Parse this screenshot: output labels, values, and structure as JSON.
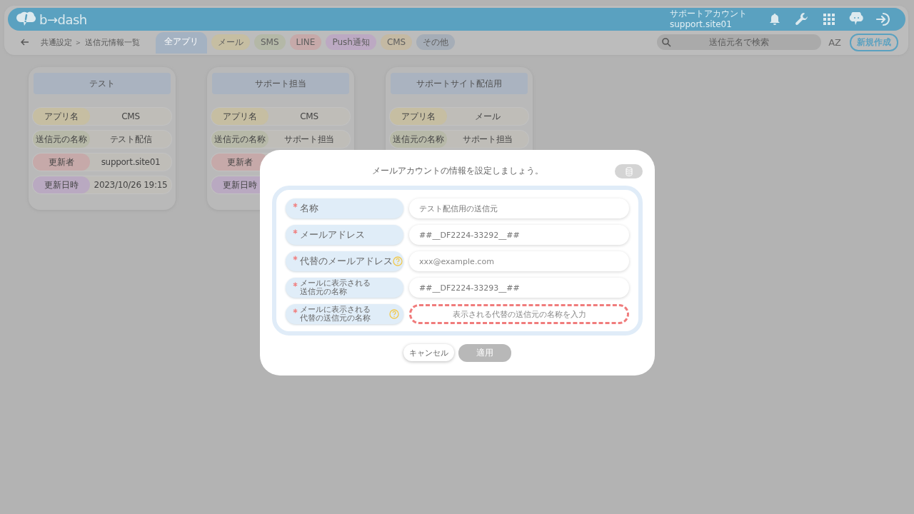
{
  "header": {
    "logo": "b→dash",
    "account_name": "サポートアカウント",
    "account_id": "support.site01"
  },
  "toolbar": {
    "breadcrumb": "共通設定 ＞ 送信元情報一覧",
    "filters": [
      {
        "label": "全アプリ",
        "selected": true,
        "color": "#a4b2c2"
      },
      {
        "label": "メール",
        "selected": false,
        "color": "#c6bea2"
      },
      {
        "label": "SMS",
        "selected": false,
        "color": "#b4b8a7"
      },
      {
        "label": "LINE",
        "selected": false,
        "color": "#c6a9a9"
      },
      {
        "label": "Push通知",
        "selected": false,
        "color": "#bca9c3"
      },
      {
        "label": "CMS",
        "selected": false,
        "color": "#c4b9a3"
      },
      {
        "label": "その他",
        "selected": false,
        "color": "#a5adb7"
      }
    ],
    "search": {
      "placeholder": "送信元名で検索"
    },
    "sort": "AZ",
    "new_button": "新規作成"
  },
  "cards": [
    {
      "title": "テスト",
      "rows": [
        {
          "label": "アプリ名",
          "value": "CMS",
          "color": "#c6bea2"
        },
        {
          "label": "送信元の名称",
          "value": "テスト配信",
          "color": "#b7b9a8"
        },
        {
          "label": "更新者",
          "value": "support.site01",
          "color": "#c6a9a9"
        },
        {
          "label": "更新日時",
          "value": "2023/10/26 19:15",
          "color": "#b9a9c1"
        }
      ]
    },
    {
      "title": "サポート担当",
      "rows": [
        {
          "label": "アプリ名",
          "value": "CMS",
          "color": "#c6bea2"
        },
        {
          "label": "送信元の名称",
          "value": "サポート担当",
          "color": "#b7b9a8"
        },
        {
          "label": "更新者",
          "color": "#c6a9a9"
        },
        {
          "label": "更新日時",
          "color": "#b9a9c1"
        }
      ]
    },
    {
      "title": "サポートサイト配信用",
      "rows": [
        {
          "label": "アプリ名",
          "value": "メール",
          "color": "#c6bea2"
        },
        {
          "label": "送信元の名称",
          "value": "サポート担当",
          "color": "#b7b9a8"
        }
      ]
    }
  ],
  "modal": {
    "title": "メールアカウントの情報を設定しましょう。",
    "fields": [
      {
        "label": "名称",
        "required": true,
        "help": false,
        "value": "テスト配信用の送信元",
        "invalid": false
      },
      {
        "label": "メールアドレス",
        "required": true,
        "help": false,
        "value": "##__DF2224-33292__##",
        "invalid": false
      },
      {
        "label": "代替のメールアドレス",
        "required": true,
        "help": true,
        "placeholder": "xxx@example.com",
        "invalid": false
      },
      {
        "label": "メールに表示される送信元の名称",
        "required": true,
        "help": false,
        "value": "##__DF2224-33293__##",
        "invalid": false
      },
      {
        "label": "メールに表示される代替の送信元の名称",
        "required": true,
        "help": true,
        "placeholder": "表示される代替の送信元の名称を入力",
        "invalid": true
      }
    ],
    "cancel": "キャンセル",
    "apply": {
      "label": "適用",
      "disabled": true
    }
  }
}
